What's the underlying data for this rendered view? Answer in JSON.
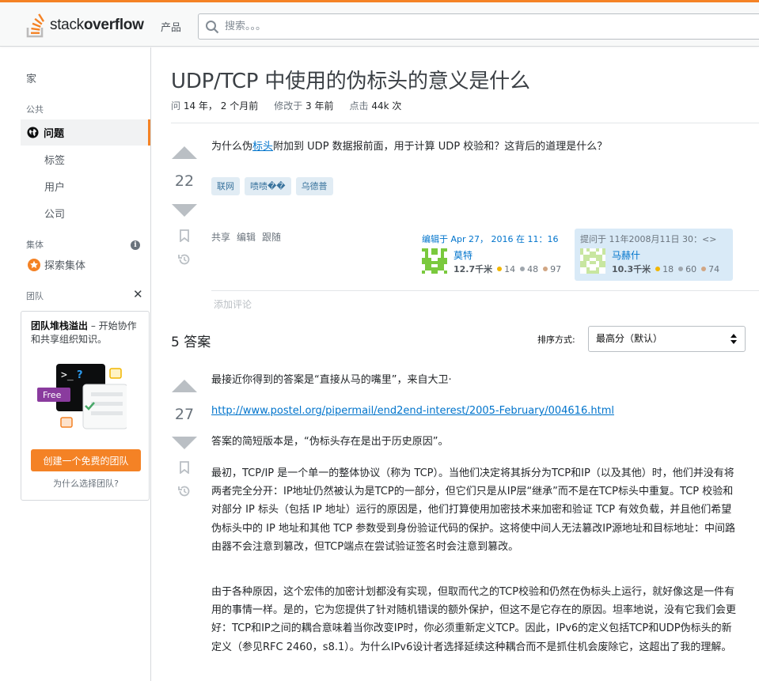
{
  "header": {
    "logo_plain": "stack",
    "logo_bold": "overflow",
    "products": "产品",
    "search_placeholder": "搜索。。。"
  },
  "leftnav": {
    "home": "家",
    "section_public": "公共",
    "questions": "问题",
    "tags": "标签",
    "users": "用户",
    "companies": "公司",
    "section_collectives": "集体",
    "explore_collectives": "探索集体",
    "section_teams": "团队",
    "teams_title": "团队堆栈溢出",
    "teams_desc": " – 开始协作和共享组织知识。",
    "free_badge": "Free",
    "create_team": "创建一个免费的团队",
    "why_teams": "为什么选择团队?"
  },
  "question": {
    "title": "UDP/TCP 中使用的伪标头的意义是什么",
    "asked_label": "问",
    "asked_value": "14 年， 2 个月前",
    "modified_label": "修改于",
    "modified_value": "3 年前",
    "viewed_label": "点击",
    "viewed_value": "44k 次",
    "votes": "22",
    "body_before": "为什么伪",
    "body_link": "标头",
    "body_after": "附加到 UDP 数据报前面，用于计算 UDP 校验和？这背后的道理是什么？",
    "tags": [
      "联网",
      "啧啧��",
      "乌德普"
    ],
    "menu": [
      "共享",
      "编辑",
      "跟随"
    ],
    "editor": {
      "action": "编辑于 Apr 27， 2016 在 11：16",
      "name": "莫特",
      "rep": "12.7千米",
      "gold": "14",
      "silver": "48",
      "bronze": "97"
    },
    "asker": {
      "action": "提问于 11年2008月11日 30：<>",
      "name": "马赫什",
      "rep": "10.3千米",
      "gold": "18",
      "silver": "60",
      "bronze": "74"
    },
    "add_comment": "添加评论"
  },
  "answers": {
    "count_label": "5 答案",
    "sort_label": "排序方式:",
    "sort_value": "最高分（默认）",
    "top": {
      "votes": "27",
      "p1": "最接近你得到的答案是“直接从马的嘴里”，来自大卫·",
      "link": "http://www.postel.org/pipermail/end2end-interest/2005-February/004616.html",
      "p2": "答案的简短版本是，“伪标头存在是出于历史原因”。",
      "p3": "最初，TCP/IP 是一个单一的整体协议（称为 TCP）。当他们决定将其拆分为TCP和IP（以及其他）时，他们并没有将两者完全分开：IP地址仍然被认为是TCP的一部分，但它们只是从IP层“继承”而不是在TCP标头中重复。TCP 校验和对部分 IP 标头（包括 IP 地址）运行的原因是，他们打算使用加密技术来加密和验证 TCP 有效负载，并且他们希望伪标头中的 IP 地址和其他 TCP 参数受到身份验证代码的保护。这将使中间人无法篡改IP源地址和目标地址：中间路由器不会注意到篡改，但TCP端点在尝试验证签名时会注意到篡改。",
      "p4": "由于各种原因，这个宏伟的加密计划都没有实现，但取而代之的TCP校验和仍然在伪标头上运行，就好像这是一件有用的事情一样。是的，它为您提供了针对随机错误的额外保护，但这不是它存在的原因。坦率地说，没有它我们会更好：TCP和IP之间的耦合意味着当你改变IP时，你必须重新定义TCP。因此，IPv6的定义包括TCP和UDP伪标头的新定义（参见RFC 2460，s8.1）。为什么IPv6设计者选择延续这种耦合而不是抓住机会废除它，这超出了我的理解。"
    }
  },
  "colors": {
    "accent": "#f48225",
    "link": "#0074cc",
    "tag_bg": "#e1ecf4",
    "tag_fg": "#39739d",
    "asker_card_bg": "#d9eaf7",
    "gold": "#f1b600",
    "silver": "#9fa6ad",
    "bronze": "#d1a684"
  }
}
